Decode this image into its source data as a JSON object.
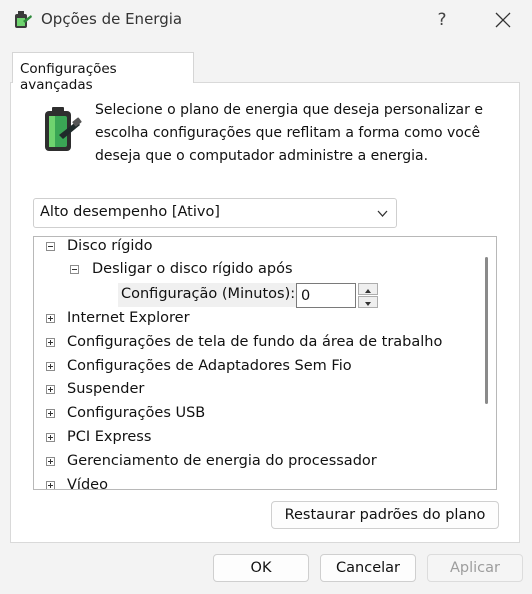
{
  "window": {
    "title": "Opções de Energia",
    "help_label": "?",
    "icon": "power-options-icon"
  },
  "tabs": [
    {
      "label": "Configurações avançadas",
      "active": true
    }
  ],
  "description": "Selecione o plano de energia que deseja personalizar e escolha configurações que reflitam a forma como você deseja que o computador administre a energia.",
  "plan_select": {
    "value": "Alto desempenho [Ativo]",
    "icon": "chevron-down-icon"
  },
  "tree": {
    "disk": {
      "label": "Disco rígido",
      "expanded": true,
      "child": {
        "label": "Desligar o disco rígido após",
        "expanded": true,
        "setting": {
          "label": "Configuração (Minutos):",
          "value": "0"
        }
      }
    },
    "items": [
      {
        "label": "Internet Explorer"
      },
      {
        "label": "Configurações de tela de fundo da área de trabalho"
      },
      {
        "label": "Configurações de Adaptadores Sem Fio"
      },
      {
        "label": "Suspender"
      },
      {
        "label": "Configurações USB"
      },
      {
        "label": "PCI Express"
      },
      {
        "label": "Gerenciamento de energia do processador"
      },
      {
        "label": "Vídeo"
      }
    ]
  },
  "buttons": {
    "restore": "Restaurar padrões do plano",
    "ok": "OK",
    "cancel": "Cancelar",
    "apply": "Aplicar"
  },
  "colors": {
    "window_bg": "#f3f3f3",
    "panel_bg": "#ffffff",
    "battery_green": "#3aa655",
    "disabled_text": "#9d9d9d"
  }
}
